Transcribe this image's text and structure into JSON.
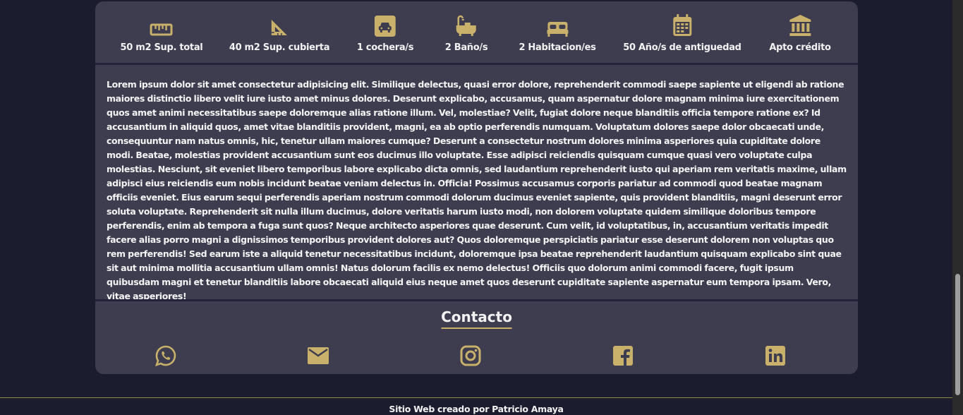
{
  "colors": {
    "background": "#1b1d2e",
    "card": "#3d3d4f",
    "accent": "#c9b16b",
    "text": "#f2f2f2"
  },
  "features": [
    {
      "icon": "ruler-icon",
      "label": "50 m2 Sup. total"
    },
    {
      "icon": "set-square-icon",
      "label": "40 m2 Sup. cubierta"
    },
    {
      "icon": "car-icon",
      "label": "1 cochera/s"
    },
    {
      "icon": "bathtub-icon",
      "label": "2 Baño/s"
    },
    {
      "icon": "bed-icon",
      "label": "2 Habitacion/es"
    },
    {
      "icon": "calendar-icon",
      "label": "50 Año/s de antiguedad"
    },
    {
      "icon": "bank-icon",
      "label": "Apto crédito"
    }
  ],
  "description": "Lorem ipsum dolor sit amet consectetur adipisicing elit. Similique delectus, quasi error dolore, reprehenderit commodi saepe sapiente ut eligendi ab ratione maiores distinctio libero velit iure iusto amet minus dolores. Deserunt explicabo, accusamus, quam aspernatur dolore magnam minima iure exercitationem quos amet animi necessitatibus saepe doloremque alias ratione illum. Vel, molestiae? Velit, fugiat dolore neque blanditiis officia tempore ratione ex? Id accusantium in aliquid quos, amet vitae blanditiis provident, magni, ea ab optio perferendis numquam. Voluptatum dolores saepe dolor obcaecati unde, consequuntur nam natus omnis, hic, tenetur ullam maiores cumque? Deserunt a consectetur nostrum dolores minima asperiores quia cupiditate dolore modi. Beatae, molestias provident accusantium sunt eos ducimus illo voluptate. Esse adipisci reiciendis quisquam cumque quasi vero voluptate culpa molestias. Nesciunt, sit eveniet libero temporibus labore explicabo dicta omnis, sed laudantium reprehenderit iusto qui aperiam rem veritatis maxime, ullam adipisci eius reiciendis eum nobis incidunt beatae veniam delectus in. Officia! Possimus accusamus corporis pariatur ad commodi quod beatae magnam officiis eveniet. Eius earum sequi perferendis aperiam nostrum commodi dolorum ducimus eveniet sapiente, quis provident blanditiis, magni deserunt error soluta voluptate. Reprehenderit sit nulla illum ducimus, dolore veritatis harum iusto modi, non dolorem voluptate quidem similique doloribus tempore perferendis, enim ab tempora a fuga sunt quos? Neque architecto asperiores quae deserunt. Cum velit, id voluptatibus, in, accusantium veritatis impedit facere alias porro magni a dignissimos temporibus provident dolores aut? Quos doloremque perspiciatis pariatur esse deserunt dolorem non voluptas quo rem perferendis! Sed earum iste a aliquid tenetur necessitatibus incidunt, doloremque ipsa beatae reprehenderit laudantium quisquam explicabo sint quae sit aut minima mollitia accusantium ullam omnis! Natus dolorum facilis ex nemo delectus! Officiis quo dolorum animi commodi facere, fugit ipsum quibusdam magni et tenetur blanditiis labore obcaecati aliquid eius neque amet quos deserunt cupiditate sapiente aspernatur eum tempora ipsam. Vero, vitae asperiores!",
  "contact": {
    "title": "Contacto",
    "links": [
      {
        "icon": "whatsapp-icon"
      },
      {
        "icon": "email-icon"
      },
      {
        "icon": "instagram-icon"
      },
      {
        "icon": "facebook-icon"
      },
      {
        "icon": "linkedin-icon"
      }
    ]
  },
  "footer": {
    "text": "Sitio Web creado por Patricio Amaya"
  }
}
